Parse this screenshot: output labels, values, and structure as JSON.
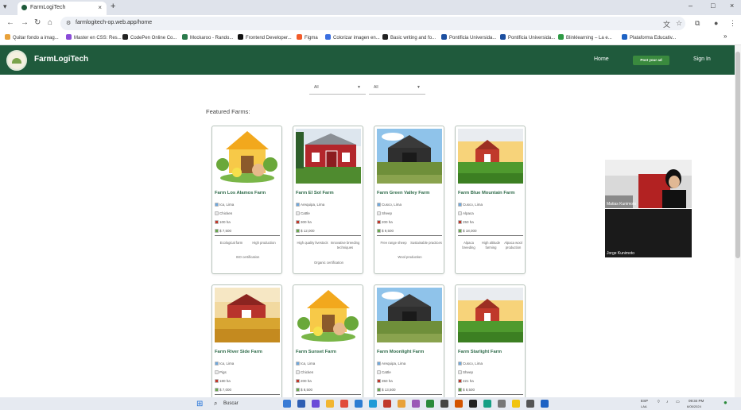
{
  "browser": {
    "tab_title": "FarmLogiTech",
    "tab_close": "×",
    "new_tab": "+",
    "address": "farmlogitech-op.web.app/home",
    "window_controls": [
      "–",
      "□",
      "×"
    ],
    "bookmarks": [
      {
        "label": "Quitar fondo a imag...",
        "color": "#e8a13a"
      },
      {
        "label": "Master en CSS: Res...",
        "color": "#8a4bd8"
      },
      {
        "label": "CodePen Online Co...",
        "color": "#222222"
      },
      {
        "label": "Mockaroo - Rando...",
        "color": "#2a7a4b"
      },
      {
        "label": "Frontend Developer...",
        "color": "#111111"
      },
      {
        "label": "Figma",
        "color": "#f25b2a"
      },
      {
        "label": "Colorizar imagen en...",
        "color": "#3b6fe0"
      },
      {
        "label": "Basic writing and fo...",
        "color": "#222222"
      },
      {
        "label": "Pontificia Universida...",
        "color": "#1c4fa0"
      },
      {
        "label": "Pontificia Universida...",
        "color": "#1c4fa0"
      },
      {
        "label": "Blinklearning – La e...",
        "color": "#2e9a44"
      },
      {
        "label": "Plataforma Educativ...",
        "color": "#1d62c4"
      }
    ]
  },
  "navbar": {
    "brand": "FarmLogiTech",
    "home": "Home",
    "cta": "Post your ad",
    "sign_in": "Sign In",
    "bg_color": "#1f5a3c"
  },
  "filters": [
    {
      "value": "All"
    },
    {
      "value": "All"
    }
  ],
  "featured_title": "Featured Farms:",
  "farms": [
    {
      "name": "Farm Los Alamos Farm",
      "location": "Ica, Lima",
      "animal": "Chicken",
      "area": "100 ha",
      "price": "$ 7,500",
      "tags": [
        "Ecological farm",
        "High production"
      ],
      "tag3": "ISO certification",
      "image": "cartoon"
    },
    {
      "name": "Farm El Sol Farm",
      "location": "Arequipa, Lima",
      "animal": "Cattle",
      "area": "300 ha",
      "price": "$ 12,000",
      "tags": [
        "High quality livestock",
        "Innovative breeding techniques"
      ],
      "tag3": "Organic certification",
      "image": "redbarn"
    },
    {
      "name": "Farm Green Valley Farm",
      "location": "Cusco, Lima",
      "animal": "Sheep",
      "area": "200 ha",
      "price": "$ 9,500",
      "tags": [
        "Free range sheep",
        "Sustainable practices"
      ],
      "tag3": "Wool production",
      "image": "darkbarn"
    },
    {
      "name": "Farm Blue Mountain Farm",
      "location": "Cusco, Lima",
      "animal": "Alpaca",
      "area": "250 ha",
      "price": "$ 18,000",
      "tags": [
        "Alpaca breeding",
        "High altitude farming",
        "Alpaca wool production"
      ],
      "tag3": "",
      "image": "sunsetbarn"
    },
    {
      "name": "Farm River Side Farm",
      "location": "Ica, Lima",
      "animal": "Pigs",
      "area": "180 ha",
      "price": "$ 7,000",
      "tags": [],
      "tag3": "",
      "image": "wheatbarn"
    },
    {
      "name": "Farm Sunset Farm",
      "location": "Ica, Lima",
      "animal": "Chicken",
      "area": "200 ha",
      "price": "$ 8,500",
      "tags": [],
      "tag3": "",
      "image": "cartoon"
    },
    {
      "name": "Farm Moonlight Farm",
      "location": "Arequipa, Lima",
      "animal": "Cattle",
      "area": "350 ha",
      "price": "$ 13,500",
      "tags": [],
      "tag3": "",
      "image": "darkbarn"
    },
    {
      "name": "Farm Starlight Farm",
      "location": "Cusco, Lima",
      "animal": "Sheep",
      "area": "221 ha",
      "price": "$ 8,500",
      "tags": [],
      "tag3": "",
      "image": "sunsetbarn"
    }
  ],
  "video_call": {
    "participants": [
      {
        "name": "Matias Kunimoto"
      },
      {
        "name": "Jorge Kunimoto"
      }
    ]
  },
  "taskbar": {
    "search_placeholder": "Buscar",
    "lang": "ESP",
    "lang_sub": "LAA",
    "time": "09:34 PM",
    "date": "6/05/2024"
  }
}
